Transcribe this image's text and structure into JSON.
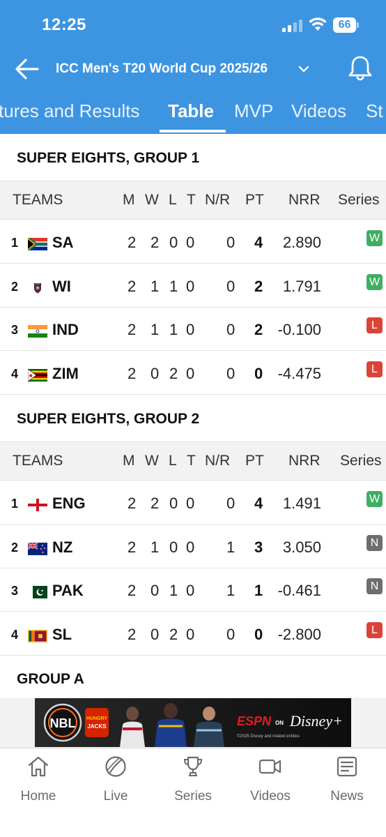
{
  "status_bar": {
    "time": "12:25",
    "battery": "66"
  },
  "nav": {
    "title": "ICC Men's T20 World Cup 2025/26"
  },
  "tabs": [
    {
      "label": "tures and Results",
      "active": false
    },
    {
      "label": "Table",
      "active": true
    },
    {
      "label": "MVP",
      "active": false
    },
    {
      "label": "Videos",
      "active": false
    },
    {
      "label": "St",
      "active": false
    }
  ],
  "columns": {
    "teams": "TEAMS",
    "m": "M",
    "w": "W",
    "l": "L",
    "t": "T",
    "nr": "N/R",
    "pt": "PT",
    "nrr": "NRR",
    "series": "Series"
  },
  "groups": [
    {
      "title": "SUPER EIGHTS, GROUP 1",
      "rows": [
        {
          "rank": "1",
          "team": "SA",
          "flag": "south-africa-flag",
          "m": "2",
          "w": "2",
          "l": "0",
          "t": "0",
          "nr": "0",
          "pt": "4",
          "nrr": "2.890",
          "series": "W"
        },
        {
          "rank": "2",
          "team": "WI",
          "flag": "west-indies-flag",
          "m": "2",
          "w": "1",
          "l": "1",
          "t": "0",
          "nr": "0",
          "pt": "2",
          "nrr": "1.791",
          "series": "W"
        },
        {
          "rank": "3",
          "team": "IND",
          "flag": "india-flag",
          "m": "2",
          "w": "1",
          "l": "1",
          "t": "0",
          "nr": "0",
          "pt": "2",
          "nrr": "-0.100",
          "series": "L"
        },
        {
          "rank": "4",
          "team": "ZIM",
          "flag": "zimbabwe-flag",
          "m": "2",
          "w": "0",
          "l": "2",
          "t": "0",
          "nr": "0",
          "pt": "0",
          "nrr": "-4.475",
          "series": "L"
        }
      ]
    },
    {
      "title": "SUPER EIGHTS, GROUP 2",
      "rows": [
        {
          "rank": "1",
          "team": "ENG",
          "flag": "england-flag",
          "m": "2",
          "w": "2",
          "l": "0",
          "t": "0",
          "nr": "0",
          "pt": "4",
          "nrr": "1.491",
          "series": "W"
        },
        {
          "rank": "2",
          "team": "NZ",
          "flag": "new-zealand-flag",
          "m": "2",
          "w": "1",
          "l": "0",
          "t": "0",
          "nr": "1",
          "pt": "3",
          "nrr": "3.050",
          "series": "N"
        },
        {
          "rank": "3",
          "team": "PAK",
          "flag": "pakistan-flag",
          "m": "2",
          "w": "0",
          "l": "1",
          "t": "0",
          "nr": "1",
          "pt": "1",
          "nrr": "-0.461",
          "series": "N"
        },
        {
          "rank": "4",
          "team": "SL",
          "flag": "sri-lanka-flag",
          "m": "2",
          "w": "0",
          "l": "2",
          "t": "0",
          "nr": "0",
          "pt": "0",
          "nrr": "-2.800",
          "series": "L"
        }
      ]
    }
  ],
  "next_group_title": "GROUP A",
  "ad": {
    "nbl": "NBL",
    "sponsor_top": "HUNGRY",
    "sponsor_bottom": "JACKS",
    "espn": "ESPN",
    "on": "ON",
    "disney": "Disney+",
    "fine_print": "©2025 Disney and related entities"
  },
  "bottom_nav": [
    {
      "label": "Home",
      "icon": "home-icon"
    },
    {
      "label": "Live",
      "icon": "cricket-ball-icon"
    },
    {
      "label": "Series",
      "icon": "trophy-icon"
    },
    {
      "label": "Videos",
      "icon": "video-camera-icon"
    },
    {
      "label": "News",
      "icon": "news-icon"
    }
  ],
  "colors": {
    "header": "#3d95e2",
    "win": "#3fae61",
    "loss": "#d94437",
    "no_result": "#6e6e6e"
  }
}
